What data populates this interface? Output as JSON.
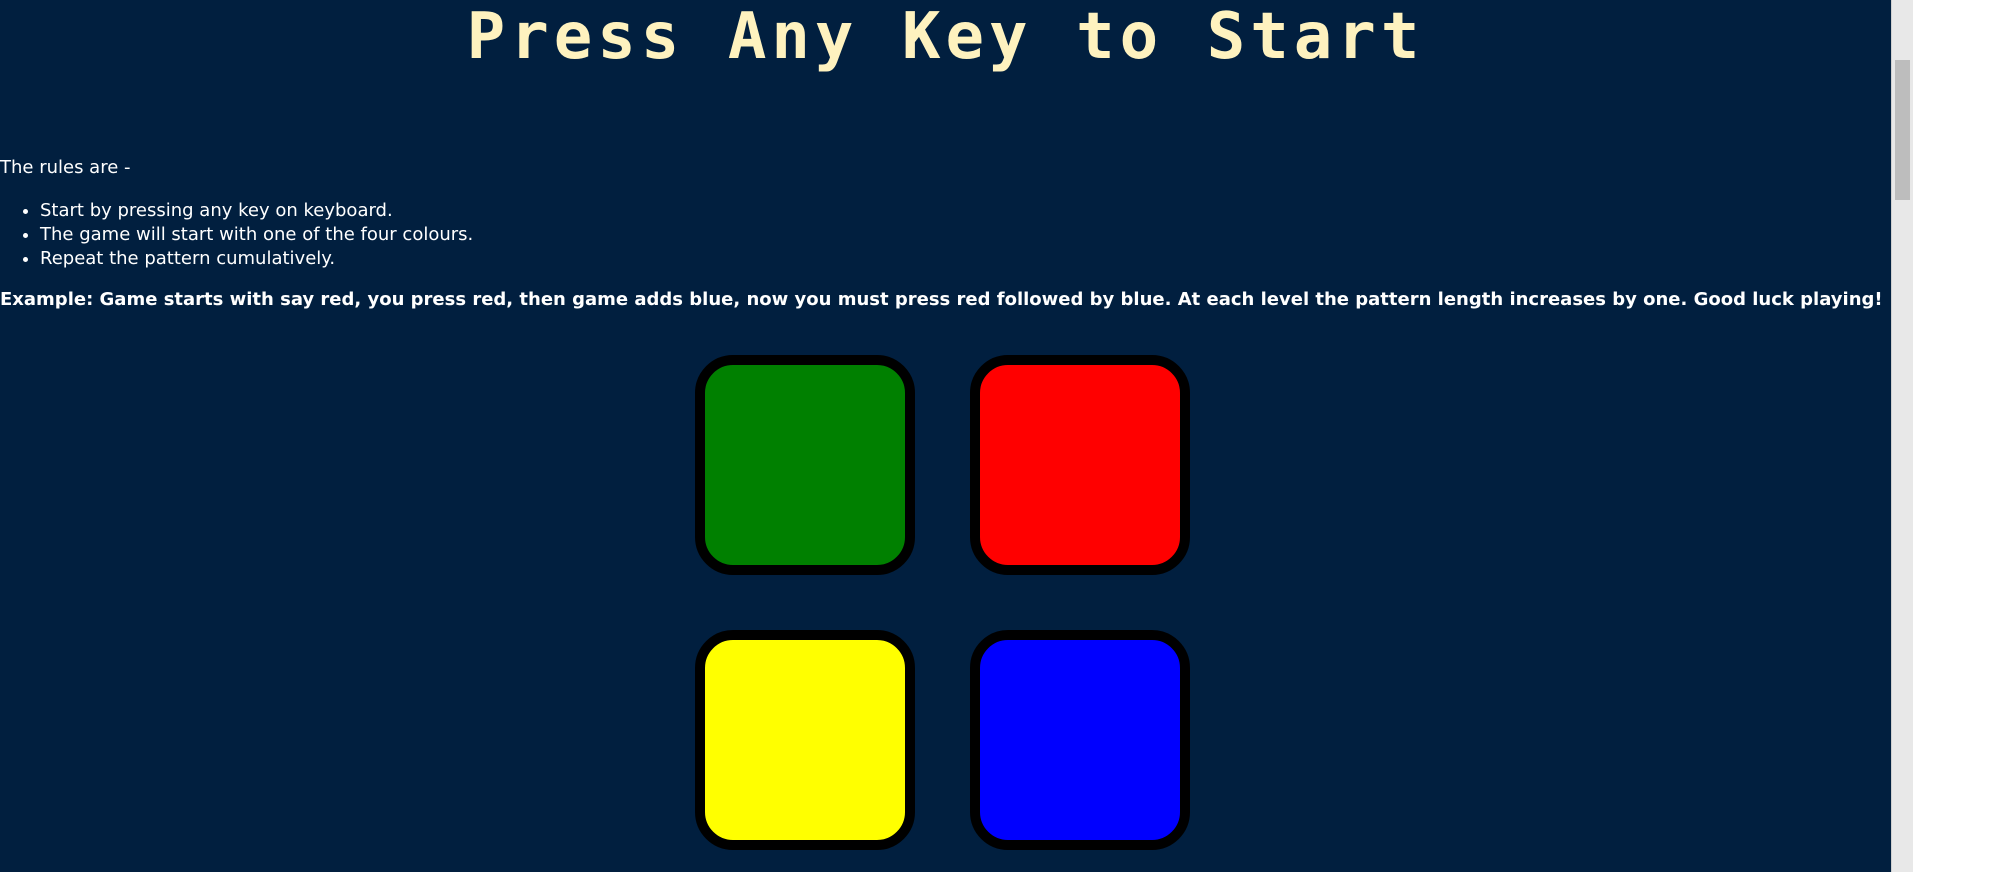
{
  "game": {
    "title": "Press Any Key to Start"
  },
  "rules": {
    "intro": "The rules are -",
    "items": [
      "Start by pressing any key on keyboard.",
      "The game will start with one of the four colours.",
      "Repeat the pattern cumulatively."
    ],
    "example": "Example: Game starts with say red, you press red, then game adds blue, now you must press red followed by blue. At each level the pattern length increases by one. Good luck playing!"
  },
  "colors": {
    "background": "#011f3f",
    "title": "#fef2bf",
    "green": "#008000",
    "red": "#ff0000",
    "yellow": "#ffff00",
    "blue": "#0000ff",
    "border": "#000000"
  },
  "buttons": [
    {
      "id": "green",
      "color": "#008000"
    },
    {
      "id": "red",
      "color": "#ff0000"
    },
    {
      "id": "yellow",
      "color": "#ffff00"
    },
    {
      "id": "blue",
      "color": "#0000ff"
    }
  ]
}
